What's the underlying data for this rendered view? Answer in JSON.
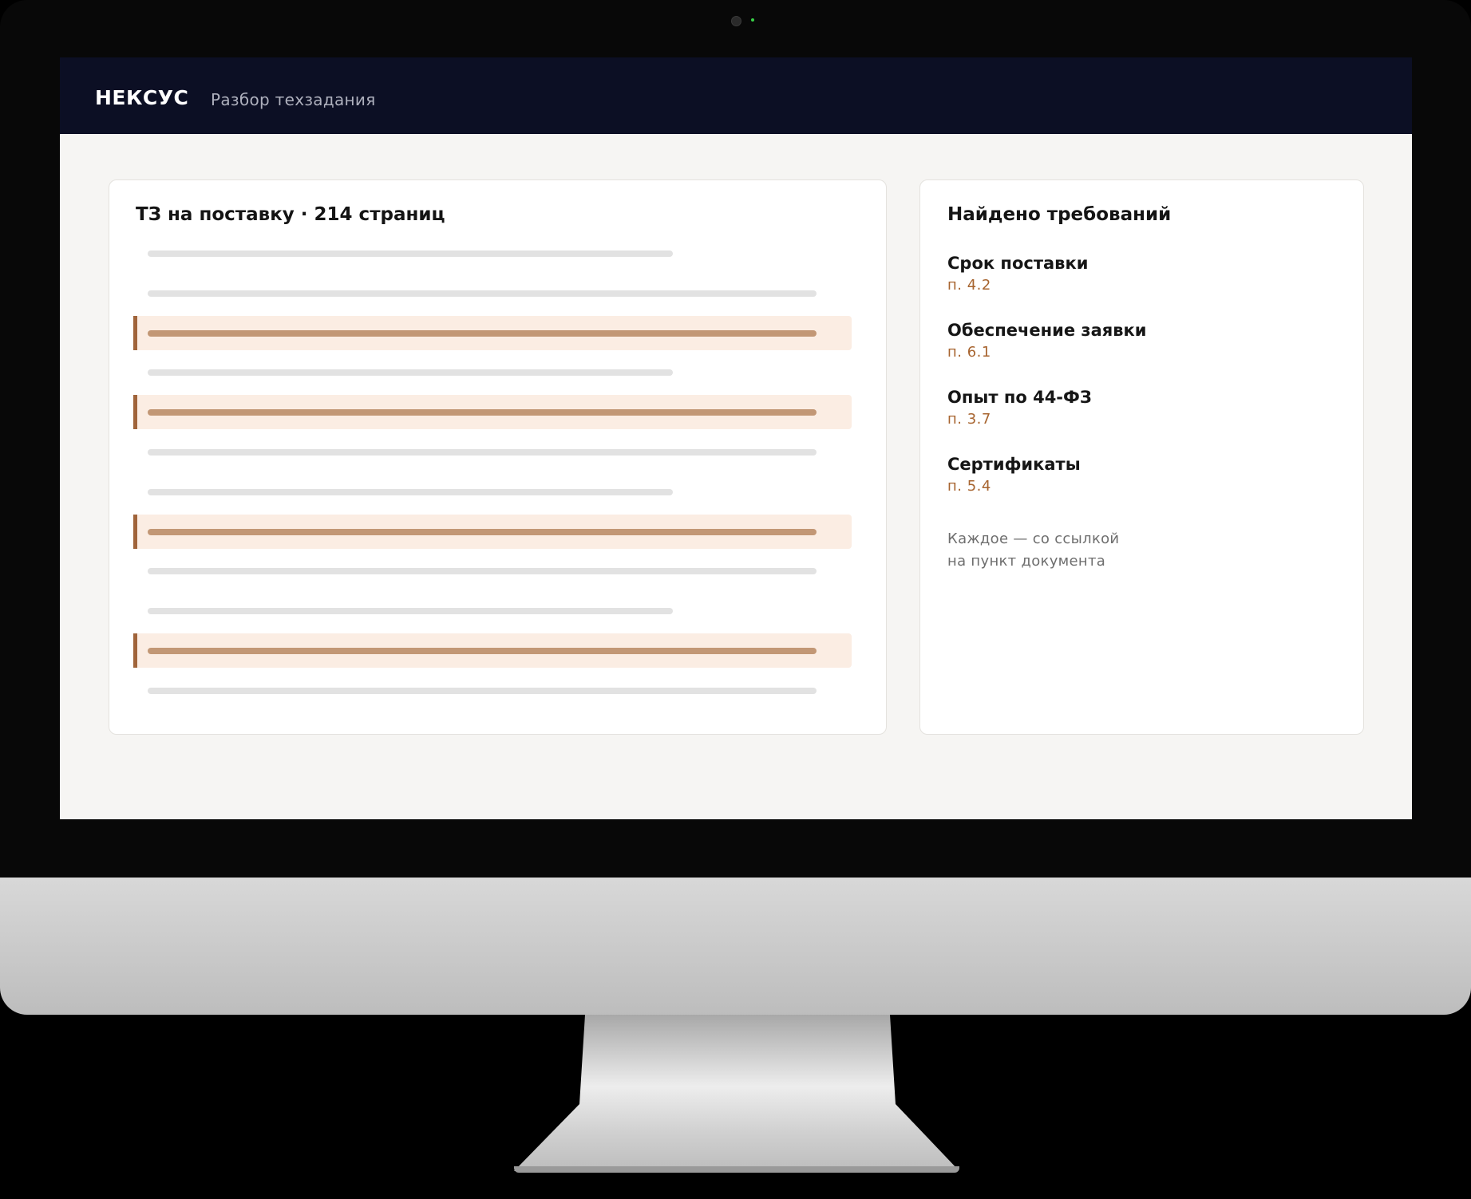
{
  "header": {
    "brand": "НЕКСУС",
    "subtitle": "Разбор техзадания"
  },
  "document": {
    "title": "ТЗ на поставку · 214 страниц",
    "lines": [
      {
        "highlighted": false,
        "length": "short"
      },
      {
        "highlighted": false,
        "length": "long"
      },
      {
        "highlighted": true,
        "length": "long"
      },
      {
        "highlighted": false,
        "length": "short"
      },
      {
        "highlighted": true,
        "length": "long"
      },
      {
        "highlighted": false,
        "length": "long"
      },
      {
        "highlighted": false,
        "length": "short"
      },
      {
        "highlighted": true,
        "length": "long"
      },
      {
        "highlighted": false,
        "length": "long"
      },
      {
        "highlighted": false,
        "length": "short"
      },
      {
        "highlighted": true,
        "length": "long"
      },
      {
        "highlighted": false,
        "length": "long"
      }
    ]
  },
  "requirements": {
    "title": "Найдено требований",
    "items": [
      {
        "label": "Срок поставки",
        "ref": "п. 4.2"
      },
      {
        "label": "Обеспечение заявки",
        "ref": "п. 6.1"
      },
      {
        "label": "Опыт по 44-ФЗ",
        "ref": "п. 3.7"
      },
      {
        "label": "Сертификаты",
        "ref": "п. 5.4"
      }
    ],
    "note_line1": "Каждое — со ссылкой",
    "note_line2": "на пункт документа"
  },
  "colors": {
    "topbar": "#0c0f24",
    "accent": "#a0643a",
    "highlight_bg": "#fbede3",
    "highlight_bar": "#c29775",
    "ref_text": "#a7642f"
  }
}
